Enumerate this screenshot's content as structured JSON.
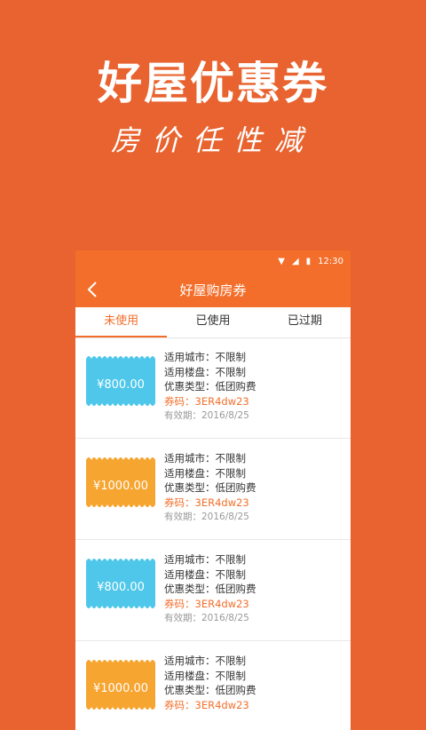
{
  "promo": {
    "title": "好屋优惠券",
    "subtitle": "房价任性减"
  },
  "statusbar": {
    "time": "12:30"
  },
  "appbar": {
    "title": "好屋购房券"
  },
  "tabs": [
    {
      "label": "未使用"
    },
    {
      "label": "已使用"
    },
    {
      "label": "已过期"
    }
  ],
  "coupons": [
    {
      "amount": "¥800.00",
      "color": "#4EC7EA",
      "city": "适用城市：不限制",
      "property": "适用楼盘：不限制",
      "type": "优惠类型：低团购费",
      "code": "券码：3ER4dw23",
      "expiry": "有效期：2016/8/25"
    },
    {
      "amount": "¥1000.00",
      "color": "#F7A531",
      "city": "适用城市：不限制",
      "property": "适用楼盘：不限制",
      "type": "优惠类型：低团购费",
      "code": "券码：3ER4dw23",
      "expiry": "有效期：2016/8/25"
    },
    {
      "amount": "¥800.00",
      "color": "#4EC7EA",
      "city": "适用城市：不限制",
      "property": "适用楼盘：不限制",
      "type": "优惠类型：低团购费",
      "code": "券码：3ER4dw23",
      "expiry": "有效期：2016/8/25"
    },
    {
      "amount": "¥1000.00",
      "color": "#F7A531",
      "city": "适用城市：不限制",
      "property": "适用楼盘：不限制",
      "type": "优惠类型：低团购费",
      "code": "券码：3ER4dw23",
      "expiry": ""
    }
  ]
}
